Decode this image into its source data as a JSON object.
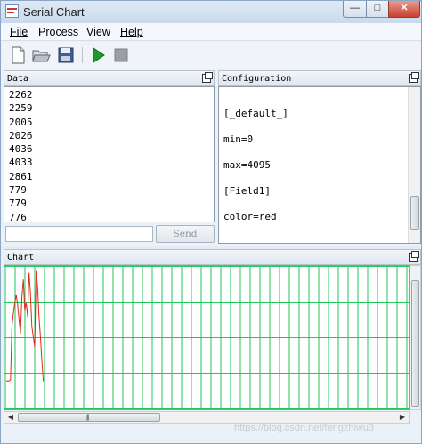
{
  "window": {
    "title": "Serial Chart"
  },
  "menu": {
    "file": "File",
    "process": "Process",
    "view": "View",
    "help": "Help"
  },
  "data_panel": {
    "title": "Data",
    "lines": [
      "2262",
      "2259",
      "2005",
      "2026",
      "4036",
      "4033",
      "2861",
      "779",
      "779",
      "776"
    ],
    "send_value": "",
    "send_label": "Send"
  },
  "config_panel": {
    "title": "Configuration",
    "lines": [
      "[_default_]",
      "min=0",
      "max=4095",
      "[Field1]",
      "color=red"
    ]
  },
  "chart_panel": {
    "title": "Chart"
  },
  "chart_data": {
    "type": "line",
    "ylim": [
      0,
      4095
    ],
    "grid": true,
    "series": [
      {
        "color": "#e0281c",
        "values": [
          800,
          780,
          790,
          820,
          2400,
          2800,
          3100,
          3350,
          3050,
          2600,
          2200,
          3300,
          3800,
          2900,
          3100,
          2700,
          4000,
          3400,
          2400,
          2100,
          1800,
          4050,
          3600,
          2700,
          2100,
          1400,
          780
        ]
      }
    ]
  },
  "watermark": "https://blog.csdn.net/fengzhiwu3"
}
